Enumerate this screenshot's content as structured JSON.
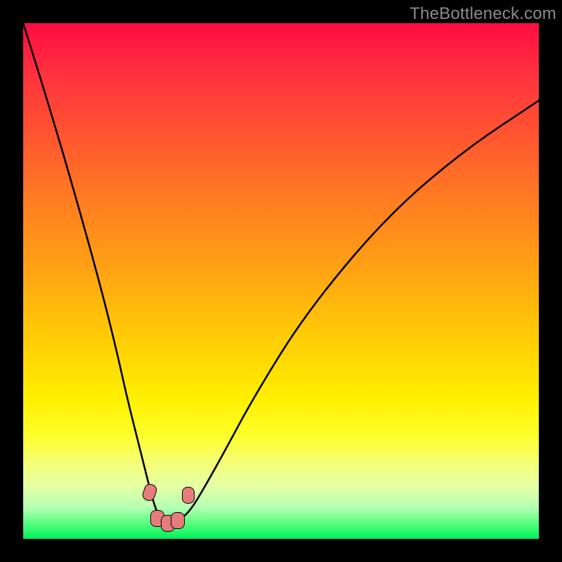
{
  "watermark": "TheBottleneck.com",
  "colors": {
    "frame_bg": "#000000",
    "gradient_top": "#ff0b44",
    "gradient_bottom": "#00ef5b",
    "curve_stroke": "#000000",
    "marker_fill": "#e77c7c",
    "marker_stroke": "#000000",
    "watermark_text": "#8a8a8a"
  },
  "chart_data": {
    "type": "line",
    "title": "",
    "xlabel": "",
    "ylabel": "",
    "xlim": [
      0,
      100
    ],
    "ylim": [
      0,
      100
    ],
    "series": [
      {
        "name": "bottleneck-curve",
        "x": [
          0,
          5,
          10,
          15,
          18,
          20,
          22,
          24,
          25,
          26,
          27,
          28,
          29,
          30,
          32,
          34,
          38,
          45,
          55,
          70,
          85,
          100
        ],
        "values": [
          100,
          84,
          67,
          49,
          37,
          28,
          20,
          12,
          8,
          5,
          3.5,
          3,
          3,
          3.5,
          5,
          8,
          15,
          28,
          44,
          62,
          75,
          85
        ]
      }
    ],
    "annotations": [
      {
        "name": "guide-marker-left",
        "x": 24.5,
        "y": 9
      },
      {
        "name": "guide-marker-bottom1",
        "x": 26.0,
        "y": 4
      },
      {
        "name": "guide-marker-bottom2",
        "x": 28.0,
        "y": 3
      },
      {
        "name": "guide-marker-bottom3",
        "x": 30.0,
        "y": 3.5
      },
      {
        "name": "guide-marker-right",
        "x": 32.0,
        "y": 8.5
      }
    ]
  }
}
